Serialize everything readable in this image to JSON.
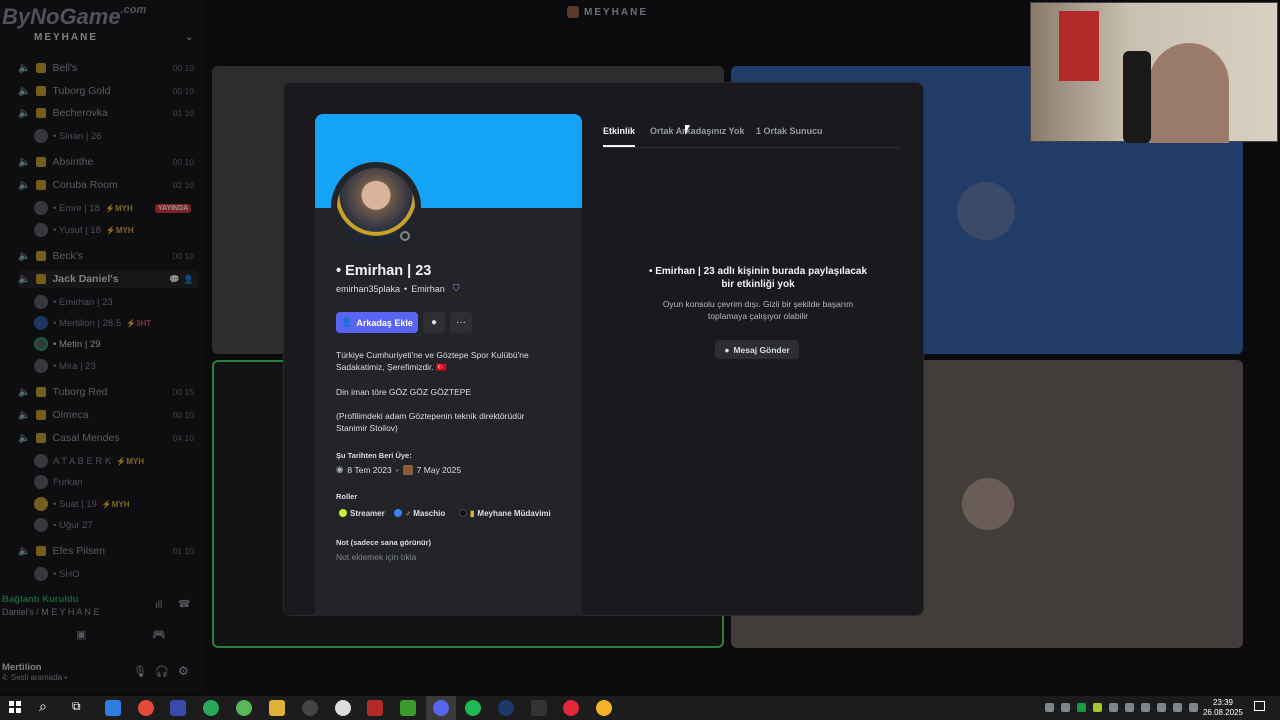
{
  "app": {
    "window_title": "MEYHANE",
    "watermark_brand": "ByNoGame",
    "watermark_suffix": ".com"
  },
  "sidebar": {
    "server_name": "MEYHANE",
    "channels": [
      {
        "name": "Bell's",
        "count": "00",
        "limit": "10"
      },
      {
        "name": "Tuborg Gold",
        "count": "00",
        "limit": "10"
      },
      {
        "name": "Becherovka",
        "count": "01",
        "limit": "10"
      },
      {
        "name": "Absinthe",
        "count": "00",
        "limit": "10"
      },
      {
        "name": "Coruba Room",
        "count": "02",
        "limit": "10"
      },
      {
        "name": "Beck's",
        "count": "00",
        "limit": "10"
      },
      {
        "name": "Jack Daniel's",
        "count": "",
        "limit": ""
      },
      {
        "name": "Tuborg Red",
        "count": "00",
        "limit": "15"
      },
      {
        "name": "Olmeca",
        "count": "00",
        "limit": "10"
      },
      {
        "name": "Casal Mendes",
        "count": "04",
        "limit": "10"
      },
      {
        "name": "Efes Pilsen",
        "count": "01",
        "limit": "10"
      }
    ],
    "members": [
      {
        "name": "• Sinan | 26",
        "tag": ""
      },
      {
        "name": "• Emre | 18",
        "tag": "⚡MYH",
        "live": "YAYINDA"
      },
      {
        "name": "• Yusuf | 18",
        "tag": "⚡MYH"
      },
      {
        "name": "• Emirhan | 23",
        "tag": ""
      },
      {
        "name": "• Mertilion | 28.5",
        "tag": "⚡3HT"
      },
      {
        "name": "• Metin | 29",
        "tag": ""
      },
      {
        "name": "• Mira | 23",
        "tag": ""
      },
      {
        "name": "A T A B E R K",
        "tag": "⚡MYH"
      },
      {
        "name": "Furkan",
        "tag": ""
      },
      {
        "name": "• Suat | 19",
        "tag": "⚡MYH"
      },
      {
        "name": "• Uğur 27",
        "tag": ""
      },
      {
        "name": "• SHO",
        "tag": ""
      }
    ],
    "voice_status": "Bağlantı Kuruldu",
    "voice_channel": "Daniel's / M E Y H A N E",
    "user_name": "Mertilion",
    "user_status": "4: Sesli aramada •"
  },
  "profile": {
    "display_name": "• Emirhan | 23",
    "username": "emirhan35plaka",
    "pronoun_sep": "•",
    "nickname": "Emirhan",
    "add_friend_label": "Arkadaş Ekle",
    "bio_line1": "Türkiye Cumhuriyeti'ne ve Göztepe Spor Kulübü'ne",
    "bio_line2": "Sadakatimiz, Şerefimizdir. 🇹🇷",
    "bio_line3": "Din iman töre GÖZ GÖZ GÖZTEPE",
    "bio_line4": "(Profilimdeki adam Göztepenin teknik direktörüdür",
    "bio_line5": "Stanimir Stoilov)",
    "member_since_label": "Şu Tarihten Beri Üye:",
    "discord_since": "8 Tem 2023",
    "server_since": "7 May 2025",
    "roles_label": "Roller",
    "roles": [
      {
        "name": "Streamer",
        "color": "#c6f135"
      },
      {
        "name": "♂ Maschio",
        "color": "#3b82f6"
      },
      {
        "name": "Meyhane Müdavimi",
        "color": "#111111"
      }
    ],
    "note_label": "Not (sadece sana görünür)",
    "note_placeholder": "Not eklemek için tıkla",
    "banner_color": "#14a3f5"
  },
  "tabs": [
    {
      "label": "Etkinlik",
      "active": true
    },
    {
      "label": "Ortak Arkadaşınız Yok",
      "active": false
    },
    {
      "label": "1 Ortak Sunucu",
      "active": false
    }
  ],
  "activity": {
    "title_line1": "• Emirhan | 23 adlı kişinin burada paylaşılacak",
    "title_line2": "bir etkinliği yok",
    "desc_line1": "Oyun konsolu çevrim dışı. Gizli bir şekilde başarım",
    "desc_line2": "toplamaya çalışıyor olabilir",
    "message_button": "Mesaj Gönder"
  },
  "taskbar": {
    "time": "23:39",
    "date": "26.08.2025"
  }
}
